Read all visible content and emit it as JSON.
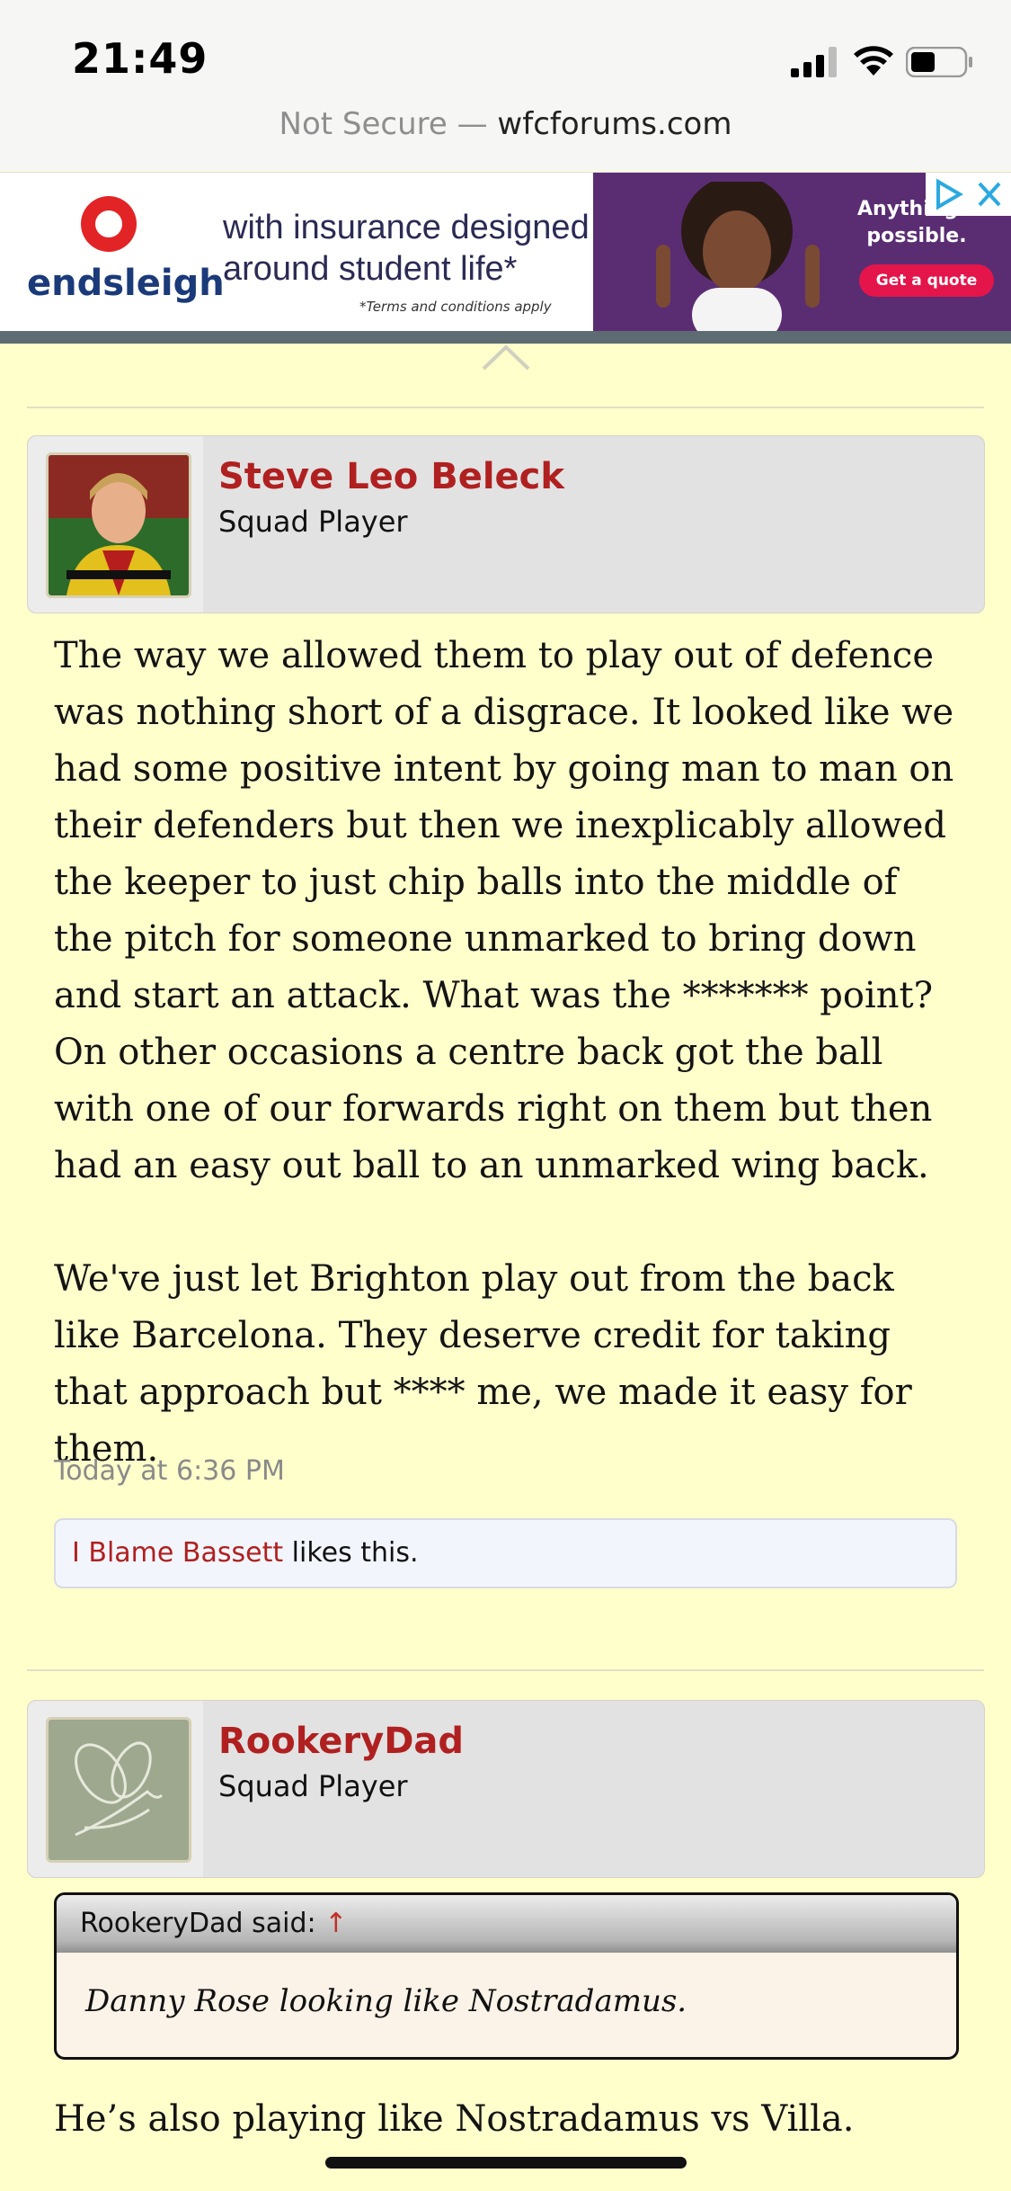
{
  "status": {
    "time": "21:49"
  },
  "browser": {
    "not_secure": "Not Secure —",
    "domain": "wfcforums.com"
  },
  "ad": {
    "brand": "endsleigh",
    "line1": "with insurance designed",
    "line2": "around student life*",
    "terms": "*Terms and conditions apply",
    "right_text": "Anything's possible.",
    "cta": "Get a quote",
    "accent": "#5a2d73"
  },
  "posts": [
    {
      "user": "Steve Leo Beleck",
      "title": "Squad Player",
      "body": [
        "The way we allowed them to play out of defence was nothing short of a disgrace. It looked like we had some positive intent by going man to man on their defenders but then we inexplicably allowed the keeper to just chip balls into the middle of the pitch for someone unmarked to bring down and start an attack. What was the ******* point? On other occasions a centre back got the ball with one of our forwards right on them but then had an easy out ball to an unmarked wing back.",
        "We've just let Brighton play out from the back like Barcelona. They deserve credit for taking that approach but **** me, we made it easy for them."
      ],
      "timestamp": "Today at 6:36 PM",
      "liker": "I Blame Bassett",
      "likes_text": " likes this."
    },
    {
      "user": "RookeryDad",
      "title": "Squad Player",
      "quote_author": "RookeryDad said:",
      "quote_arrow": "↑",
      "quote_text": "Danny Rose looking like Nostradamus.",
      "body": [
        "He’s also playing like Nostradamus vs Villa."
      ]
    }
  ],
  "colors": {
    "username": "#b02020",
    "page_bg": "#ffffcc"
  }
}
